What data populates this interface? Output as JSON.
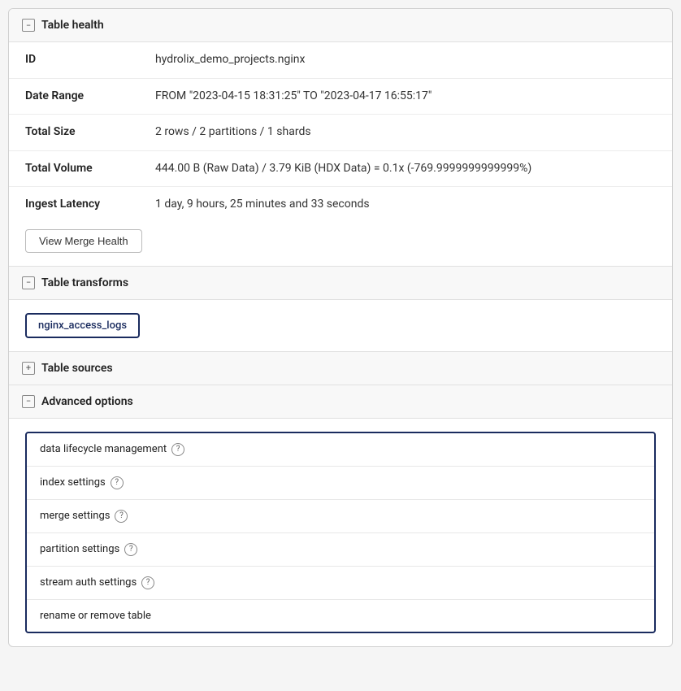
{
  "tableHealth": {
    "title": "Table health",
    "collapseIcon": "−",
    "rows": [
      {
        "label": "ID",
        "value": "hydrolix_demo_projects.nginx"
      },
      {
        "label": "Date Range",
        "value": "FROM \"2023-04-15 18:31:25\" TO \"2023-04-17 16:55:17\""
      },
      {
        "label": "Total Size",
        "value": "2 rows / 2 partitions / 1 shards"
      },
      {
        "label": "Total Volume",
        "value": "444.00 B (Raw Data) / 3.79 KiB (HDX Data) = 0.1x (-769.9999999999999%)"
      },
      {
        "label": "Ingest Latency",
        "value": "1 day, 9 hours, 25 minutes and 33 seconds"
      }
    ],
    "viewMergeHealthButton": "View Merge Health"
  },
  "tableTransforms": {
    "title": "Table transforms",
    "collapseIcon": "−",
    "transform": "nginx_access_logs"
  },
  "tableSources": {
    "title": "Table sources",
    "expandIcon": "+"
  },
  "advancedOptions": {
    "title": "Advanced options",
    "collapseIcon": "−",
    "items": [
      {
        "label": "data lifecycle management",
        "hasHelp": true
      },
      {
        "label": "index settings",
        "hasHelp": true
      },
      {
        "label": "merge settings",
        "hasHelp": true
      },
      {
        "label": "partition settings",
        "hasHelp": true
      },
      {
        "label": "stream auth settings",
        "hasHelp": true
      },
      {
        "label": "rename or remove table",
        "hasHelp": false
      }
    ]
  }
}
